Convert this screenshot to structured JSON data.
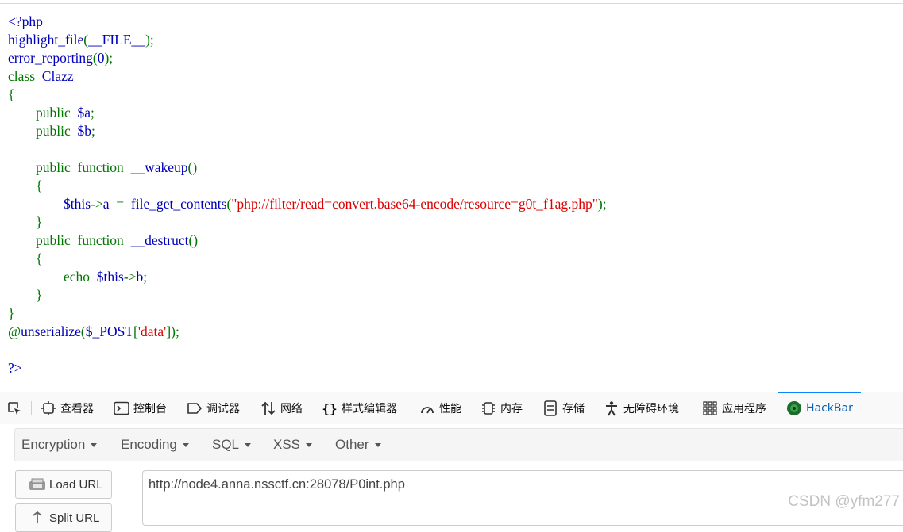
{
  "source_code": {
    "lines": [
      [
        {
          "c": "c-default",
          "t": "<?php"
        }
      ],
      [
        {
          "c": "c-default",
          "t": "highlight_file"
        },
        {
          "c": "c-keyword",
          "t": "("
        },
        {
          "c": "c-default",
          "t": "__FILE__"
        },
        {
          "c": "c-keyword",
          "t": ");"
        }
      ],
      [
        {
          "c": "c-default",
          "t": "error_reporting"
        },
        {
          "c": "c-keyword",
          "t": "("
        },
        {
          "c": "c-default",
          "t": "0"
        },
        {
          "c": "c-keyword",
          "t": ");"
        }
      ],
      [
        {
          "c": "c-keyword",
          "t": "class  "
        },
        {
          "c": "c-default",
          "t": "Clazz"
        }
      ],
      [
        {
          "c": "c-keyword",
          "t": "{"
        }
      ],
      [
        {
          "c": "c-keyword",
          "t": "        public  "
        },
        {
          "c": "c-default",
          "t": "$a"
        },
        {
          "c": "c-keyword",
          "t": ";"
        }
      ],
      [
        {
          "c": "c-keyword",
          "t": "        public  "
        },
        {
          "c": "c-default",
          "t": "$b"
        },
        {
          "c": "c-keyword",
          "t": ";"
        }
      ],
      [
        {
          "c": "c-keyword",
          "t": ""
        }
      ],
      [
        {
          "c": "c-keyword",
          "t": "        public  function  "
        },
        {
          "c": "c-default",
          "t": "__wakeup"
        },
        {
          "c": "c-keyword",
          "t": "()"
        }
      ],
      [
        {
          "c": "c-keyword",
          "t": "        {"
        }
      ],
      [
        {
          "c": "c-keyword",
          "t": "                "
        },
        {
          "c": "c-default",
          "t": "$this"
        },
        {
          "c": "c-keyword",
          "t": "->"
        },
        {
          "c": "c-default",
          "t": "a  "
        },
        {
          "c": "c-keyword",
          "t": "=  "
        },
        {
          "c": "c-default",
          "t": "file_get_contents"
        },
        {
          "c": "c-keyword",
          "t": "("
        },
        {
          "c": "c-string",
          "t": "\"php://filter/read=convert.base64-encode/resource=g0t_f1ag.php\""
        },
        {
          "c": "c-keyword",
          "t": ");"
        }
      ],
      [
        {
          "c": "c-keyword",
          "t": "        }"
        }
      ],
      [
        {
          "c": "c-keyword",
          "t": "        public  function  "
        },
        {
          "c": "c-default",
          "t": "__destruct"
        },
        {
          "c": "c-keyword",
          "t": "()"
        }
      ],
      [
        {
          "c": "c-keyword",
          "t": "        {"
        }
      ],
      [
        {
          "c": "c-keyword",
          "t": "                echo  "
        },
        {
          "c": "c-default",
          "t": "$this"
        },
        {
          "c": "c-keyword",
          "t": "->"
        },
        {
          "c": "c-default",
          "t": "b"
        },
        {
          "c": "c-keyword",
          "t": ";"
        }
      ],
      [
        {
          "c": "c-keyword",
          "t": "        }"
        }
      ],
      [
        {
          "c": "c-keyword",
          "t": "}"
        }
      ],
      [
        {
          "c": "c-keyword",
          "t": "@"
        },
        {
          "c": "c-default",
          "t": "unserialize"
        },
        {
          "c": "c-keyword",
          "t": "("
        },
        {
          "c": "c-default",
          "t": "$_POST"
        },
        {
          "c": "c-keyword",
          "t": "["
        },
        {
          "c": "c-string",
          "t": "'data'"
        },
        {
          "c": "c-keyword",
          "t": "]);"
        }
      ],
      [
        {
          "c": "c-keyword",
          "t": ""
        }
      ],
      [
        {
          "c": "c-default",
          "t": "?>"
        }
      ]
    ]
  },
  "colors": {
    "default": "#0000bb",
    "keyword": "#007700",
    "string": "#dd0000",
    "accent": "#0a84ff"
  },
  "devtools": {
    "picker_icon": "element-picker-icon",
    "tabs": [
      {
        "label": "查看器",
        "icon": "inspector-icon"
      },
      {
        "label": "控制台",
        "icon": "console-icon"
      },
      {
        "label": "调试器",
        "icon": "debugger-icon"
      },
      {
        "label": "网络",
        "icon": "network-icon"
      },
      {
        "label": "样式编辑器",
        "icon": "style-editor-icon"
      },
      {
        "label": "性能",
        "icon": "performance-icon"
      },
      {
        "label": "内存",
        "icon": "memory-icon"
      },
      {
        "label": "存储",
        "icon": "storage-icon"
      },
      {
        "label": "无障碍环境",
        "icon": "accessibility-icon"
      },
      {
        "label": "应用程序",
        "icon": "application-icon"
      },
      {
        "label": "HackBar",
        "icon": "hackbar-icon",
        "active": true
      }
    ]
  },
  "hackbar": {
    "menu": [
      {
        "label": "Encryption"
      },
      {
        "label": "Encoding"
      },
      {
        "label": "SQL"
      },
      {
        "label": "XSS"
      },
      {
        "label": "Other"
      }
    ],
    "load_url_label": "Load URL",
    "split_url_label": "Split URL",
    "url_value": "http://node4.anna.nssctf.cn:28078/P0int.php"
  },
  "watermark": "CSDN @yfm277"
}
